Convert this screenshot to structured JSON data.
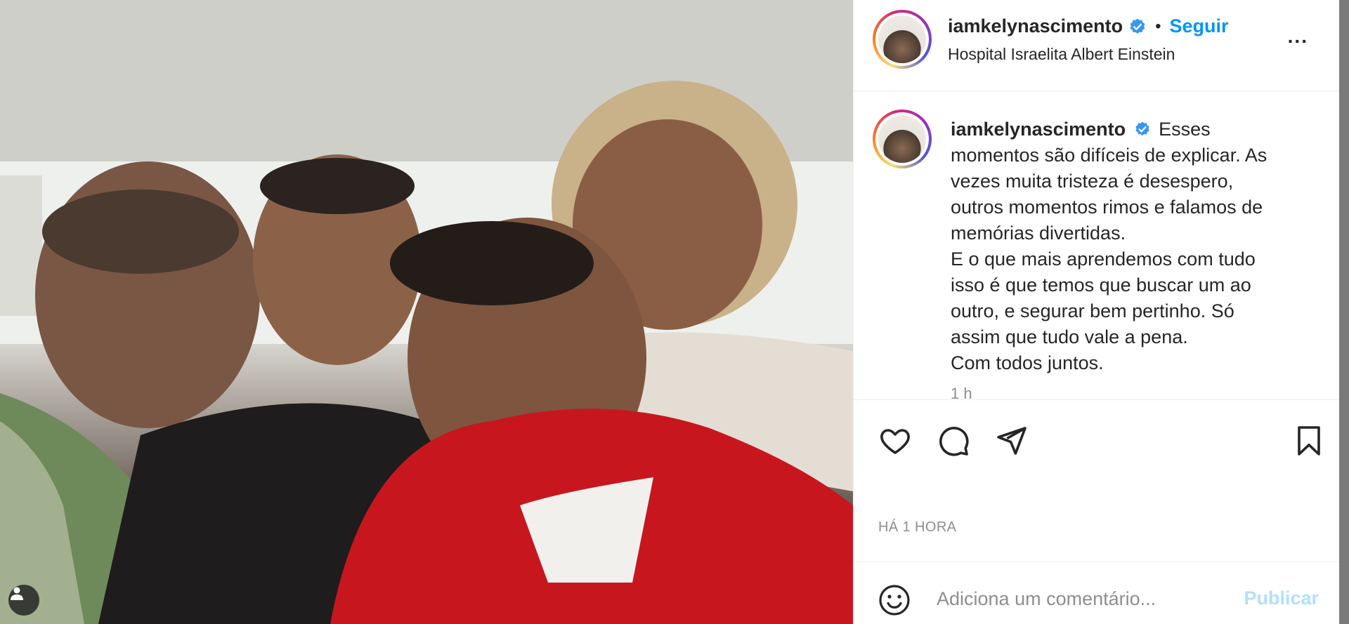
{
  "post": {
    "username": "iamkelynascimento",
    "verified": true,
    "separator": "•",
    "follow_label": "Seguir",
    "location": "Hospital Israelita Albert Einstein",
    "more_label": "..."
  },
  "caption": {
    "username": "iamkelynascimento",
    "lines": [
      "Esses",
      "momentos são difíceis de explicar. As",
      "vezes muita tristeza é desespero,",
      "outros momentos rimos e falamos de",
      "memórias divertidas.",
      "E o que mais aprendemos com tudo",
      "isso é que temos que buscar um ao",
      "outro, e segurar bem pertinho. Só",
      "assim que tudo vale a pena.",
      "Com todos juntos."
    ],
    "time": "1 h"
  },
  "actions": {
    "like_icon": "heart-icon",
    "comment_icon": "comment-icon",
    "share_icon": "paper-plane-icon",
    "save_icon": "bookmark-icon"
  },
  "posted_time": "HÁ 1 HORA",
  "comment_box": {
    "emoji_icon": "smiley-icon",
    "placeholder": "Adiciona um comentário...",
    "publish_label": "Publicar"
  },
  "photo": {
    "user_tag_icon": "user-tag-icon"
  },
  "colors": {
    "accent": "#0095f6",
    "publish_disabled": "#b2dffc",
    "verified": "#3897f0",
    "text": "#262626",
    "muted": "#8e8e8e"
  }
}
